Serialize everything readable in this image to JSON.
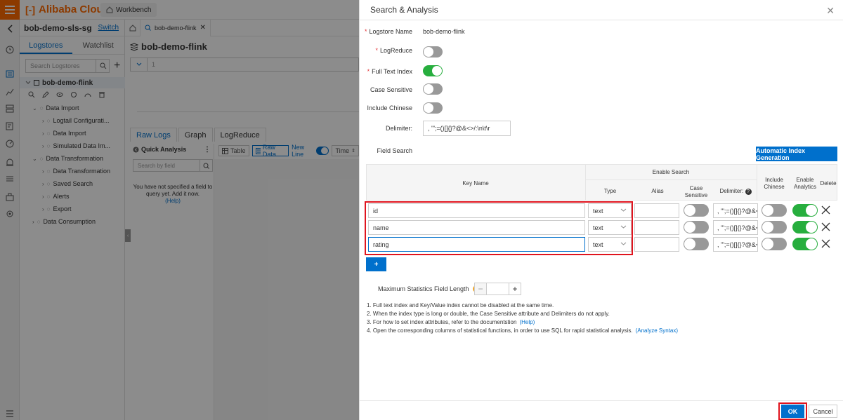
{
  "topbar": {
    "brand": "Alibaba Cloud",
    "workbench": "Workbench"
  },
  "project": {
    "name": "bob-demo-sls-sg",
    "switch_label": "Switch"
  },
  "left_tabs": [
    "Logstores",
    "Watchlist"
  ],
  "logstore_search": {
    "placeholder": "Search Logstores"
  },
  "logstore": {
    "name": "bob-demo-flink"
  },
  "tree": [
    {
      "label": "Data Import",
      "level": 1
    },
    {
      "label": "Logtail Configurati...",
      "level": 2
    },
    {
      "label": "Data Import",
      "level": 2
    },
    {
      "label": "Simulated Data Im...",
      "level": 2
    },
    {
      "label": "Data Transformation",
      "level": 1
    },
    {
      "label": "Data Transformation",
      "level": 2
    },
    {
      "label": "Saved Search",
      "level": 2
    },
    {
      "label": "Alerts",
      "level": 2
    },
    {
      "label": "Export",
      "level": 2
    },
    {
      "label": "Data Consumption",
      "level": 1
    }
  ],
  "main": {
    "tab_label": "bob-demo-flink",
    "title": "bob-demo-flink",
    "result_tabs": [
      "Raw Logs",
      "Graph",
      "LogReduce"
    ],
    "quick_analysis": {
      "title": "Quick Analysis",
      "search_placeholder": "Search by field",
      "message": "You have not specified a field to query yet. Add it now.",
      "help": "(Help)"
    },
    "view_bar": {
      "table": "Table",
      "raw_data": "Raw Data",
      "new_line": "New Line",
      "time": "Time"
    }
  },
  "drawer": {
    "title": "Search & Analysis",
    "logstore_name_label": "Logstore Name",
    "logstore_name_value": "bob-demo-flink",
    "logreduce_label": "LogReduce",
    "fulltext_label": "Full Text Index",
    "case_sensitive_label": "Case Sensitive",
    "include_chinese_label": "Include Chinese",
    "delimiter_label": "Delimiter:",
    "delimiter_value": ", '\";=()[]{}?@&<>/:\\n\\t\\r",
    "field_search_label": "Field Search",
    "auto_index_btn": "Automatic Index Generation",
    "table_headers": {
      "key_name": "Key Name",
      "enable_search": "Enable Search",
      "type": "Type",
      "alias": "Alias",
      "case_sensitive": "Case Sensitive",
      "delimiter": "Delimiter:",
      "include_chinese": "Include Chinese",
      "enable_analytics": "Enable Analytics",
      "delete": "Delete"
    },
    "fields": [
      {
        "key": "id",
        "type": "text",
        "alias": "",
        "delimiter": ", '\";=()[]{}?@&<",
        "case_sensitive": false,
        "include_chinese": false,
        "enable_analytics": true
      },
      {
        "key": "name",
        "type": "text",
        "alias": "",
        "delimiter": ", '\";=()[]{}?@&<",
        "case_sensitive": false,
        "include_chinese": false,
        "enable_analytics": true
      },
      {
        "key": "rating",
        "type": "text",
        "alias": "",
        "delimiter": ", '\";=()[]{}?@&<",
        "case_sensitive": false,
        "include_chinese": false,
        "enable_analytics": true
      }
    ],
    "add_btn": "+",
    "max_stat_label": "Maximum Statistics Field Length",
    "max_stat_value": "",
    "notes": [
      {
        "text": "1. Full text index and Key/Value index cannot be disabled at the same time.",
        "link": ""
      },
      {
        "text": "2. When the index type is long or double, the Case Sensitive attribute and Delimiters do not apply.",
        "link": ""
      },
      {
        "text": "3. For how to set index attributes, refer to the documentstion",
        "link": "(Help)"
      },
      {
        "text": "4. Open the corresponding columns of statistical functions, in order to use SQL for rapid statistical analysis.",
        "link": "(Analyze Syntax)"
      }
    ],
    "ok": "OK",
    "cancel": "Cancel"
  },
  "colors": {
    "accent": "#0070cc",
    "brand": "#ff6a00",
    "switch_on": "#27ae3e",
    "highlight": "#e0141e"
  }
}
